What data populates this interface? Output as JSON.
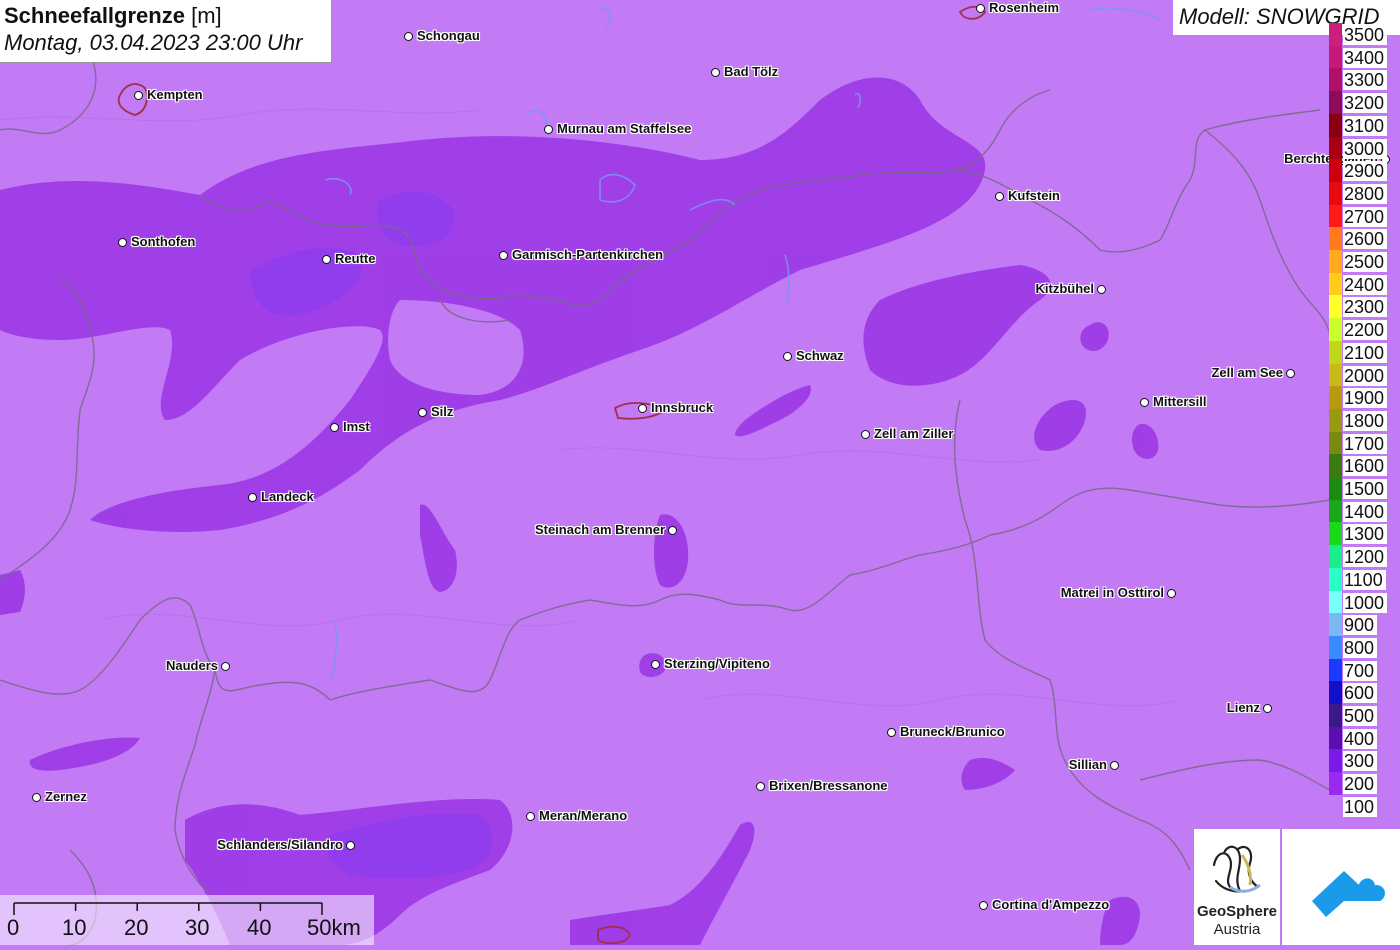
{
  "title": {
    "bold": "Schneefallgrenze",
    "unit": "[m]",
    "datetime": "Montag, 03.04.2023 23:00 Uhr"
  },
  "model": "Modell: SNOWGRID",
  "legend": [
    {
      "label": "3500",
      "color": "#cc1f7a"
    },
    {
      "label": "3400",
      "color": "#c8187a"
    },
    {
      "label": "3300",
      "color": "#b01068"
    },
    {
      "label": "3200",
      "color": "#8e0a5a"
    },
    {
      "label": "3100",
      "color": "#8a0010"
    },
    {
      "label": "3000",
      "color": "#a80010"
    },
    {
      "label": "2900",
      "color": "#cc0010"
    },
    {
      "label": "2800",
      "color": "#e80a10"
    },
    {
      "label": "2700",
      "color": "#ff1a1a"
    },
    {
      "label": "2600",
      "color": "#ff7a1a"
    },
    {
      "label": "2500",
      "color": "#ffaa1a"
    },
    {
      "label": "2400",
      "color": "#ffcc1a"
    },
    {
      "label": "2300",
      "color": "#ffff2a"
    },
    {
      "label": "2200",
      "color": "#ccff2a"
    },
    {
      "label": "2100",
      "color": "#bfd61a"
    },
    {
      "label": "2000",
      "color": "#c8b81a"
    },
    {
      "label": "1900",
      "color": "#b89a10"
    },
    {
      "label": "1800",
      "color": "#9a9a10"
    },
    {
      "label": "1700",
      "color": "#7a8a10"
    },
    {
      "label": "1600",
      "color": "#3a7a10"
    },
    {
      "label": "1500",
      "color": "#1a8a10"
    },
    {
      "label": "1400",
      "color": "#1aa81a"
    },
    {
      "label": "1300",
      "color": "#1ad81a"
    },
    {
      "label": "1200",
      "color": "#1aee8a"
    },
    {
      "label": "1100",
      "color": "#2affc8"
    },
    {
      "label": "1000",
      "color": "#7affff"
    },
    {
      "label": "900",
      "color": "#7ab8f0"
    },
    {
      "label": "800",
      "color": "#3a8aff"
    },
    {
      "label": "700",
      "color": "#1a3aff"
    },
    {
      "label": "600",
      "color": "#1010c8"
    },
    {
      "label": "500",
      "color": "#3a1a8a"
    },
    {
      "label": "400",
      "color": "#5a10b0"
    },
    {
      "label": "300",
      "color": "#7a1ae8"
    },
    {
      "label": "200",
      "color": "#9a2af0"
    },
    {
      "label": "100",
      "color": "#c27af5"
    }
  ],
  "cities": [
    {
      "name": "Rosenheim",
      "align": "right"
    },
    {
      "name": "Schongau",
      "align": "right"
    },
    {
      "name": "Bad Tölz",
      "align": "right"
    },
    {
      "name": "Kempten",
      "align": "right"
    },
    {
      "name": "Murnau am Staffelsee",
      "align": "right"
    },
    {
      "name": "Berchtesgaden",
      "align": "left"
    },
    {
      "name": "Kufstein",
      "align": "right"
    },
    {
      "name": "Sonthofen",
      "align": "right"
    },
    {
      "name": "Reutte",
      "align": "right"
    },
    {
      "name": "Garmisch-Partenkirchen",
      "align": "right"
    },
    {
      "name": "Kitzbühel",
      "align": "left"
    },
    {
      "name": "Schwaz",
      "align": "right"
    },
    {
      "name": "Zell am See",
      "align": "left"
    },
    {
      "name": "Mittersill",
      "align": "right"
    },
    {
      "name": "Innsbruck",
      "align": "right"
    },
    {
      "name": "Silz",
      "align": "right"
    },
    {
      "name": "Imst",
      "align": "right"
    },
    {
      "name": "Zell am Ziller",
      "align": "right"
    },
    {
      "name": "Landeck",
      "align": "right"
    },
    {
      "name": "Steinach am Brenner",
      "align": "left"
    },
    {
      "name": "Matrei in Osttirol",
      "align": "left"
    },
    {
      "name": "Nauders",
      "align": "left"
    },
    {
      "name": "Sterzing/Vipiteno",
      "align": "right"
    },
    {
      "name": "Lienz",
      "align": "left"
    },
    {
      "name": "Bruneck/Brunico",
      "align": "right"
    },
    {
      "name": "Sillian",
      "align": "left"
    },
    {
      "name": "Brixen/Bressanone",
      "align": "right"
    },
    {
      "name": "Zernez",
      "align": "right"
    },
    {
      "name": "Meran/Merano",
      "align": "right"
    },
    {
      "name": "Schlanders/Silandro",
      "align": "left"
    },
    {
      "name": "Cortina d'Ampezzo",
      "align": "right"
    }
  ],
  "scalebar": {
    "labels": [
      "0",
      "10",
      "20",
      "30",
      "40",
      "50km"
    ]
  },
  "logos": {
    "geosphere_line1": "GeoSphere",
    "geosphere_line2": "Austria"
  }
}
